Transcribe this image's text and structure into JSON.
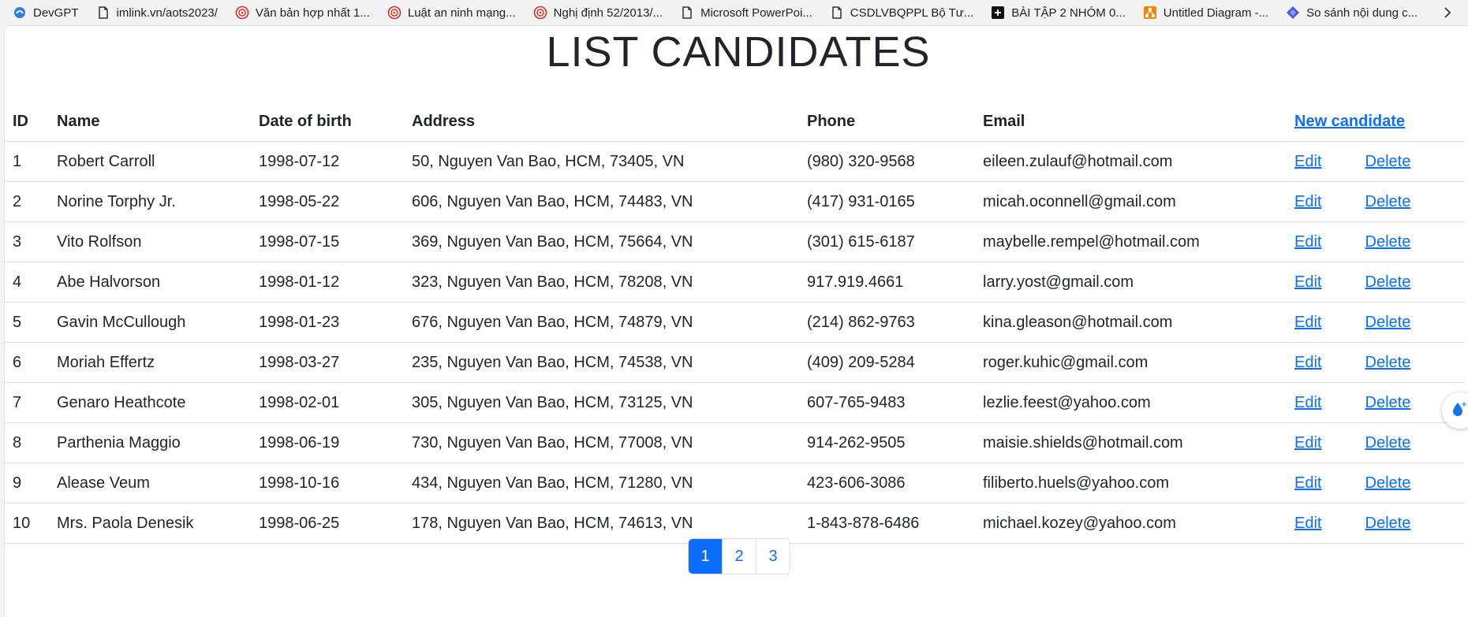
{
  "bookmarks": [
    {
      "icon": "devgpt-icon",
      "label": "DevGPT"
    },
    {
      "icon": "page-icon",
      "label": "imlink.vn/aots2023/"
    },
    {
      "icon": "seal-icon",
      "label": "Văn bản hợp nhất 1..."
    },
    {
      "icon": "seal-icon",
      "label": "Luật an ninh mạng..."
    },
    {
      "icon": "seal-icon",
      "label": "Nghị định 52/2013/..."
    },
    {
      "icon": "page-icon",
      "label": "Microsoft PowerPoi..."
    },
    {
      "icon": "page-icon",
      "label": "CSDLVBQPPL Bộ Tư..."
    },
    {
      "icon": "app-icon",
      "label": "BÀI TẬP 2 NHÓM 0..."
    },
    {
      "icon": "diagram-icon",
      "label": "Untitled Diagram -..."
    },
    {
      "icon": "diamond-icon",
      "label": "So sánh nội dung c..."
    }
  ],
  "page": {
    "title": "LIST CANDIDATES"
  },
  "table": {
    "headers": {
      "id": "ID",
      "name": "Name",
      "dob": "Date of birth",
      "address": "Address",
      "phone": "Phone",
      "email": "Email",
      "new_candidate": "New candidate"
    },
    "edit_label": "Edit",
    "delete_label": "Delete",
    "rows": [
      {
        "id": "1",
        "name": "Robert Carroll",
        "dob": "1998-07-12",
        "address": "50, Nguyen Van Bao, HCM, 73405, VN",
        "phone": "(980) 320-9568",
        "email": "eileen.zulauf@hotmail.com"
      },
      {
        "id": "2",
        "name": "Norine Torphy Jr.",
        "dob": "1998-05-22",
        "address": "606, Nguyen Van Bao, HCM, 74483, VN",
        "phone": "(417) 931-0165",
        "email": "micah.oconnell@gmail.com"
      },
      {
        "id": "3",
        "name": "Vito Rolfson",
        "dob": "1998-07-15",
        "address": "369, Nguyen Van Bao, HCM, 75664, VN",
        "phone": "(301) 615-6187",
        "email": "maybelle.rempel@hotmail.com"
      },
      {
        "id": "4",
        "name": "Abe Halvorson",
        "dob": "1998-01-12",
        "address": "323, Nguyen Van Bao, HCM, 78208, VN",
        "phone": "917.919.4661",
        "email": "larry.yost@gmail.com"
      },
      {
        "id": "5",
        "name": "Gavin McCullough",
        "dob": "1998-01-23",
        "address": "676, Nguyen Van Bao, HCM, 74879, VN",
        "phone": "(214) 862-9763",
        "email": "kina.gleason@hotmail.com"
      },
      {
        "id": "6",
        "name": "Moriah Effertz",
        "dob": "1998-03-27",
        "address": "235, Nguyen Van Bao, HCM, 74538, VN",
        "phone": "(409) 209-5284",
        "email": "roger.kuhic@gmail.com"
      },
      {
        "id": "7",
        "name": "Genaro Heathcote",
        "dob": "1998-02-01",
        "address": "305, Nguyen Van Bao, HCM, 73125, VN",
        "phone": "607-765-9483",
        "email": "lezlie.feest@yahoo.com"
      },
      {
        "id": "8",
        "name": "Parthenia Maggio",
        "dob": "1998-06-19",
        "address": "730, Nguyen Van Bao, HCM, 77008, VN",
        "phone": "914-262-9505",
        "email": "maisie.shields@hotmail.com"
      },
      {
        "id": "9",
        "name": "Alease Veum",
        "dob": "1998-10-16",
        "address": "434, Nguyen Van Bao, HCM, 71280, VN",
        "phone": "423-606-3086",
        "email": "filiberto.huels@yahoo.com"
      },
      {
        "id": "10",
        "name": "Mrs. Paola Denesik",
        "dob": "1998-06-25",
        "address": "178, Nguyen Van Bao, HCM, 74613, VN",
        "phone": "1-843-878-6486",
        "email": "michael.kozey@yahoo.com"
      }
    ]
  },
  "pagination": {
    "pages": [
      "1",
      "2",
      "3"
    ],
    "active_page": "1"
  },
  "colors": {
    "link": "#0d6efd",
    "active_page_bg": "#0d6efd",
    "border": "#dee2e6"
  }
}
